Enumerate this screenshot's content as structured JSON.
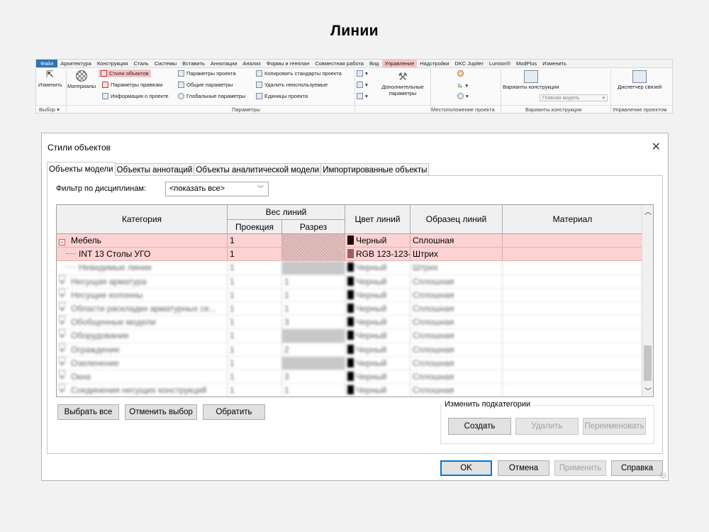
{
  "page_title": "Линии",
  "ribbon": {
    "tabs": [
      "Файл",
      "Архитектура",
      "Конструкция",
      "Сталь",
      "Системы",
      "Вставить",
      "Аннотации",
      "Анализ",
      "Формы и генплан",
      "Совместная работа",
      "Вид",
      "Управление",
      "Надстройки",
      "DKC Jupiter",
      "Lumion®",
      "ModPlus",
      "Изменить"
    ],
    "active_tab": "Управление",
    "buttons": {
      "modify": "Изменить",
      "materials": "Материалы",
      "object_styles": "Стили объектов",
      "snaps": "Параметры привязки",
      "project_info": "Информация о проекте",
      "project_params": "Параметры проекта",
      "shared_params": "Общие параметры",
      "global_params": "Глобальные параметры",
      "transfer_standards": "Копировать стандарты проекта",
      "purge_unused": "Удалить неиспользуемые",
      "project_units": "Единицы проекта",
      "additional_settings": "Дополнительные параметры",
      "design_options": "Варианты конструкции",
      "main_model": "Главная модель",
      "link_manager": "Диспетчер связей"
    },
    "groups": {
      "select": "Выбор",
      "settings": "Параметры",
      "project_location": "Местоположение проекта",
      "design_options": "Варианты конструкции",
      "manage_project": "Управление проектом"
    }
  },
  "dialog": {
    "title": "Стили объектов",
    "tabs": [
      "Объекты модели",
      "Объекты аннотаций",
      "Объекты аналитической модели",
      "Импортированные объекты"
    ],
    "filter_label": "Фильтр по дисциплинам:",
    "filter_value": "<показать все>",
    "columns": {
      "category": "Категория",
      "line_weight": "Вес линий",
      "projection": "Проекция",
      "cut": "Разрез",
      "line_color": "Цвет линий",
      "line_pattern": "Образец линий",
      "material": "Материал"
    },
    "rows": [
      {
        "category": "Мебель",
        "projection": "1",
        "cut": "",
        "color_name": "Черный",
        "color_hex": "#200000",
        "pattern": "Сплошная",
        "material": "",
        "highlight": true,
        "expanded": true,
        "level": 0
      },
      {
        "category": "INT 13 Столы УГО",
        "projection": "1",
        "cut": "",
        "color_name": "RGB 123-123-",
        "color_hex": "#9c6060",
        "pattern": "Штрих",
        "material": "",
        "highlight": true,
        "level": 1
      },
      {
        "category": "Невидимые линии",
        "projection": "1",
        "cut": "",
        "color_name": "Черный",
        "color_hex": "#000000",
        "pattern": "Штрих",
        "material": "",
        "blurred": true,
        "level": 1
      },
      {
        "category": "Несущая арматура",
        "projection": "1",
        "cut": "1",
        "color_name": "Черный",
        "color_hex": "#000000",
        "pattern": "Сплошная",
        "material": "",
        "blurred": true,
        "level": 0
      },
      {
        "category": "Несущие колонны",
        "projection": "1",
        "cut": "1",
        "color_name": "Черный",
        "color_hex": "#000000",
        "pattern": "Сплошная",
        "material": "",
        "blurred": true,
        "level": 0
      },
      {
        "category": "Области раскладки арматурных се...",
        "projection": "1",
        "cut": "1",
        "color_name": "Черный",
        "color_hex": "#000000",
        "pattern": "Сплошная",
        "material": "",
        "blurred": true,
        "level": 0
      },
      {
        "category": "Обобщенные модели",
        "projection": "1",
        "cut": "3",
        "color_name": "Черный",
        "color_hex": "#000000",
        "pattern": "Сплошная",
        "material": "",
        "blurred": true,
        "level": 0
      },
      {
        "category": "Оборудование",
        "projection": "1",
        "cut": "",
        "color_name": "Черный",
        "color_hex": "#000000",
        "pattern": "Сплошная",
        "material": "",
        "blurred": true,
        "level": 0
      },
      {
        "category": "Ограждение",
        "projection": "1",
        "cut": "2",
        "color_name": "Черный",
        "color_hex": "#000000",
        "pattern": "Сплошная",
        "material": "",
        "blurred": true,
        "level": 0
      },
      {
        "category": "Озеленение",
        "projection": "1",
        "cut": "",
        "color_name": "Черный",
        "color_hex": "#000000",
        "pattern": "Сплошная",
        "material": "",
        "blurred": true,
        "level": 0
      },
      {
        "category": "Окна",
        "projection": "1",
        "cut": "3",
        "color_name": "Черный",
        "color_hex": "#000000",
        "pattern": "Сплошная",
        "material": "",
        "blurred": true,
        "level": 0
      },
      {
        "category": "Соединения несущих конструкций",
        "projection": "1",
        "cut": "1",
        "color_name": "Черный",
        "color_hex": "#000000",
        "pattern": "Сплошная",
        "material": "",
        "blurred": true,
        "level": 0
      }
    ],
    "buttons": {
      "select_all": "Выбрать все",
      "select_none": "Отменить выбор",
      "invert": "Обратить",
      "modify_subcategories": "Изменить подкатегории",
      "new": "Создать",
      "delete": "Удалить",
      "rename": "Переименовать",
      "ok": "OK",
      "cancel": "Отмена",
      "apply": "Применить",
      "help": "Справка"
    },
    "colors": {
      "highlight": "#fcd2d2",
      "accent": "#0078d7"
    }
  }
}
